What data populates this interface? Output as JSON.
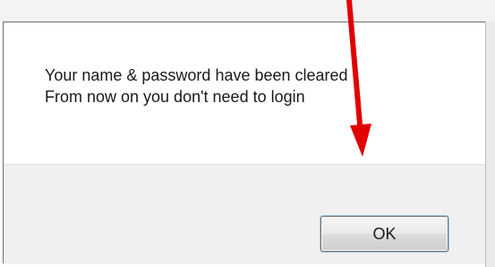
{
  "dialog": {
    "message_lines": [
      "Your name & password have been cleared",
      "From now on you don't need to login"
    ],
    "ok_label": "OK"
  },
  "background": {
    "ghost_text_left": "",
    "ghost_text_right": ""
  },
  "colors": {
    "annotation_arrow": "#e00000",
    "footer_background": "#f0f0f0",
    "border": "#6f6f6f"
  },
  "icons": {
    "annotation": "red-arrow-icon"
  }
}
